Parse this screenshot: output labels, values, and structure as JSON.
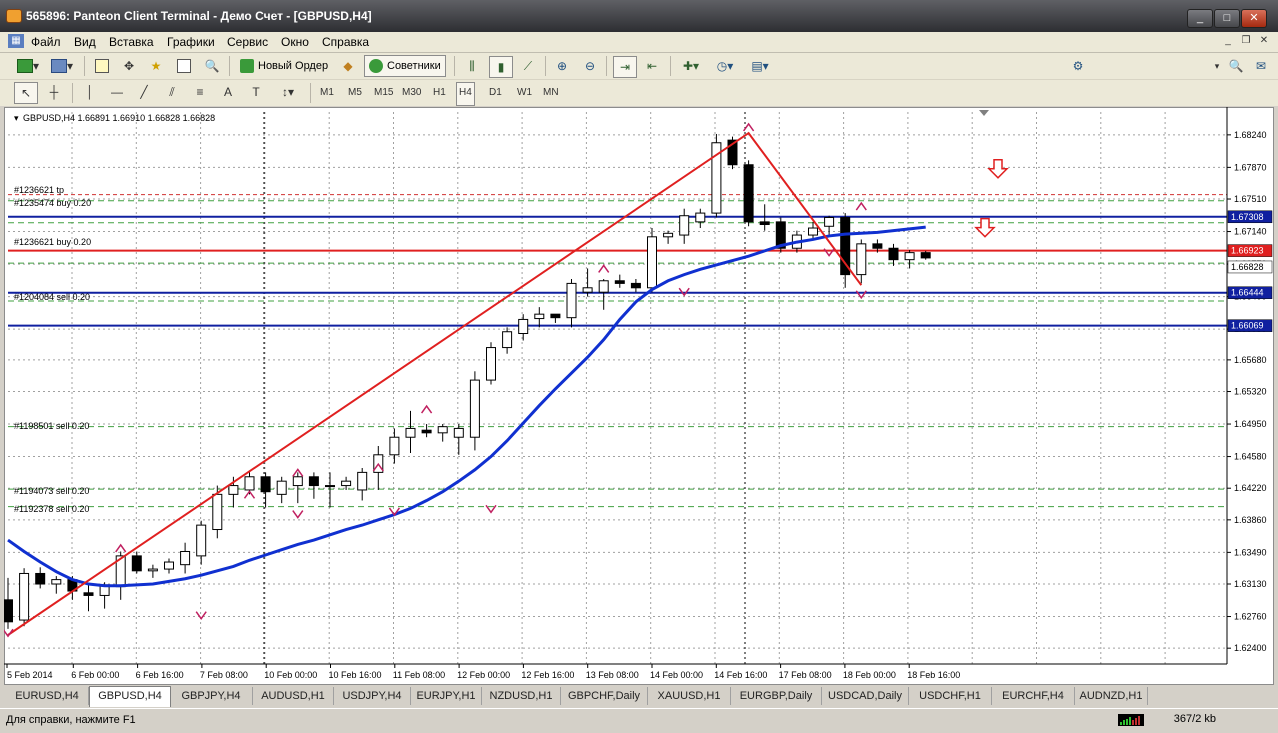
{
  "window": {
    "title": "565896: Panteon Client Terminal - Демо Счет - [GBPUSD,H4]",
    "controls": {
      "minimize": "_",
      "maximize": "□",
      "close": "✕"
    }
  },
  "menu": [
    "Файл",
    "Вид",
    "Вставка",
    "Графики",
    "Сервис",
    "Окно",
    "Справка"
  ],
  "toolbar": {
    "new_order": "Новый Ордер",
    "experts": "Советники"
  },
  "timeframes": [
    "M1",
    "M5",
    "M15",
    "M30",
    "H1",
    "H4",
    "D1",
    "W1",
    "MN"
  ],
  "active_timeframe": "H4",
  "chart": {
    "header": "GBPUSD,H4  1.66891 1.66910 1.66828 1.66828",
    "price_labels": [
      "1.68240",
      "1.67870",
      "1.67510",
      "1.67140",
      "1.66770",
      "1.66400",
      "1.66030",
      "1.65680",
      "1.65320",
      "1.64950",
      "1.64580",
      "1.64220",
      "1.63860",
      "1.63490",
      "1.63130",
      "1.62760",
      "1.62400"
    ],
    "time_labels": [
      "5 Feb 2014",
      "6 Feb 00:00",
      "6 Feb 16:00",
      "7 Feb 08:00",
      "10 Feb 00:00",
      "10 Feb 16:00",
      "11 Feb 08:00",
      "12 Feb 00:00",
      "12 Feb 16:00",
      "13 Feb 08:00",
      "14 Feb 00:00",
      "14 Feb 16:00",
      "17 Feb 08:00",
      "18 Feb 00:00",
      "18 Feb 16:00"
    ],
    "order_labels": [
      "#1236621 tp",
      "#1235474 buy 0.20",
      "#1236621 buy 0.20",
      "#1204084 sell 0.20",
      "#1198501 sell 0.20",
      "#1194073 sell 0.20",
      "#1192378 sell 0.20"
    ],
    "price_tags": [
      {
        "text": "1.67308",
        "style": "blue"
      },
      {
        "text": "1.66923",
        "style": "red"
      },
      {
        "text": "1.66828",
        "style": "white"
      },
      {
        "text": "1.66444",
        "style": "blue"
      },
      {
        "text": "1.66069",
        "style": "blue"
      }
    ]
  },
  "chart_data": {
    "type": "candlestick",
    "symbol": "GBPUSD",
    "timeframe": "H4",
    "ohlc": [
      [
        1.6295,
        1.632,
        1.6262,
        1.627
      ],
      [
        1.6272,
        1.6331,
        1.6265,
        1.6325
      ],
      [
        1.6325,
        1.6332,
        1.6308,
        1.6313
      ],
      [
        1.6313,
        1.6322,
        1.6302,
        1.6318
      ],
      [
        1.6318,
        1.6322,
        1.6295,
        1.6305
      ],
      [
        1.6303,
        1.6312,
        1.6282,
        1.63
      ],
      [
        1.63,
        1.6315,
        1.6285,
        1.6312
      ],
      [
        1.631,
        1.635,
        1.6295,
        1.6345
      ],
      [
        1.6345,
        1.635,
        1.6325,
        1.6328
      ],
      [
        1.6328,
        1.6335,
        1.632,
        1.633
      ],
      [
        1.633,
        1.6342,
        1.6325,
        1.6338
      ],
      [
        1.6335,
        1.636,
        1.6325,
        1.635
      ],
      [
        1.6345,
        1.6385,
        1.6335,
        1.638
      ],
      [
        1.6375,
        1.6425,
        1.6365,
        1.6415
      ],
      [
        1.6415,
        1.6435,
        1.64,
        1.6425
      ],
      [
        1.642,
        1.644,
        1.6415,
        1.6435
      ],
      [
        1.6435,
        1.644,
        1.64,
        1.6418
      ],
      [
        1.6415,
        1.6435,
        1.6405,
        1.643
      ],
      [
        1.6425,
        1.644,
        1.6405,
        1.6435
      ],
      [
        1.6435,
        1.644,
        1.641,
        1.6425
      ],
      [
        1.6425,
        1.644,
        1.64,
        1.6425
      ],
      [
        1.6425,
        1.6435,
        1.642,
        1.643
      ],
      [
        1.642,
        1.6445,
        1.6408,
        1.644
      ],
      [
        1.644,
        1.647,
        1.642,
        1.646
      ],
      [
        1.646,
        1.649,
        1.645,
        1.648
      ],
      [
        1.648,
        1.651,
        1.6462,
        1.649
      ],
      [
        1.6488,
        1.6495,
        1.648,
        1.6485
      ],
      [
        1.6485,
        1.6495,
        1.6475,
        1.6492
      ],
      [
        1.648,
        1.6495,
        1.646,
        1.649
      ],
      [
        1.648,
        1.6555,
        1.6465,
        1.6545
      ],
      [
        1.6545,
        1.6588,
        1.654,
        1.6582
      ],
      [
        1.6582,
        1.6605,
        1.6575,
        1.66
      ],
      [
        1.6598,
        1.662,
        1.659,
        1.6614
      ],
      [
        1.6615,
        1.6628,
        1.6605,
        1.662
      ],
      [
        1.662,
        1.662,
        1.661,
        1.6616
      ],
      [
        1.6616,
        1.666,
        1.6605,
        1.6655
      ],
      [
        1.6645,
        1.6672,
        1.664,
        1.665
      ],
      [
        1.6645,
        1.666,
        1.6625,
        1.6658
      ],
      [
        1.6658,
        1.6665,
        1.665,
        1.6655
      ],
      [
        1.6655,
        1.666,
        1.6645,
        1.665
      ],
      [
        1.665,
        1.6718,
        1.6645,
        1.6708
      ],
      [
        1.6708,
        1.6715,
        1.67,
        1.6712
      ],
      [
        1.671,
        1.674,
        1.67,
        1.6732
      ],
      [
        1.6725,
        1.674,
        1.6718,
        1.6735
      ],
      [
        1.6735,
        1.6825,
        1.673,
        1.6815
      ],
      [
        1.6818,
        1.6822,
        1.6785,
        1.679
      ],
      [
        1.679,
        1.6795,
        1.672,
        1.6725
      ],
      [
        1.6725,
        1.6745,
        1.6715,
        1.6722
      ],
      [
        1.6725,
        1.673,
        1.669,
        1.6695
      ],
      [
        1.6695,
        1.6715,
        1.669,
        1.671
      ],
      [
        1.671,
        1.6725,
        1.6705,
        1.6718
      ],
      [
        1.672,
        1.6732,
        1.671,
        1.673
      ],
      [
        1.673,
        1.6735,
        1.665,
        1.6665
      ],
      [
        1.6665,
        1.6705,
        1.6655,
        1.67
      ],
      [
        1.67,
        1.6705,
        1.669,
        1.6695
      ],
      [
        1.6695,
        1.67,
        1.6675,
        1.6682
      ],
      [
        1.6682,
        1.6693,
        1.6672,
        1.669
      ],
      [
        1.669,
        1.6692,
        1.6682,
        1.6684
      ]
    ],
    "moving_average": [
      1.6363,
      1.635,
      1.6338,
      1.6327,
      1.6318,
      1.6313,
      1.6311,
      1.6311,
      1.6312,
      1.6313,
      1.6316,
      1.6319,
      1.6323,
      1.6328,
      1.6333,
      1.634,
      1.6346,
      1.6352,
      1.6358,
      1.6363,
      1.6369,
      1.6375,
      1.638,
      1.6386,
      1.6392,
      1.6399,
      1.6408,
      1.6418,
      1.643,
      1.6443,
      1.6458,
      1.6476,
      1.6496,
      1.6516,
      1.6535,
      1.6553,
      1.6571,
      1.6591,
      1.6614,
      1.6634,
      1.6648,
      1.6658,
      1.6665,
      1.6671,
      1.6676,
      1.6681,
      1.6686,
      1.6692,
      1.6698,
      1.6702,
      1.6705,
      1.6709,
      1.6711,
      1.6712,
      1.6713,
      1.6715,
      1.6717,
      1.6719
    ],
    "levels": {
      "blue": [
        1.67308,
        1.66444,
        1.66069
      ],
      "red": [
        1.66923
      ],
      "green_dashed": [
        1.6749,
        1.6724,
        1.6678,
        1.6635,
        1.6492,
        1.6421,
        1.6401
      ],
      "red_dashed": [
        1.6756
      ]
    },
    "zigzag": [
      [
        0,
        1.6255
      ],
      [
        46,
        1.6826
      ],
      [
        53,
        1.6653
      ]
    ],
    "y_range": [
      1.6222,
      1.685
    ]
  }
}
